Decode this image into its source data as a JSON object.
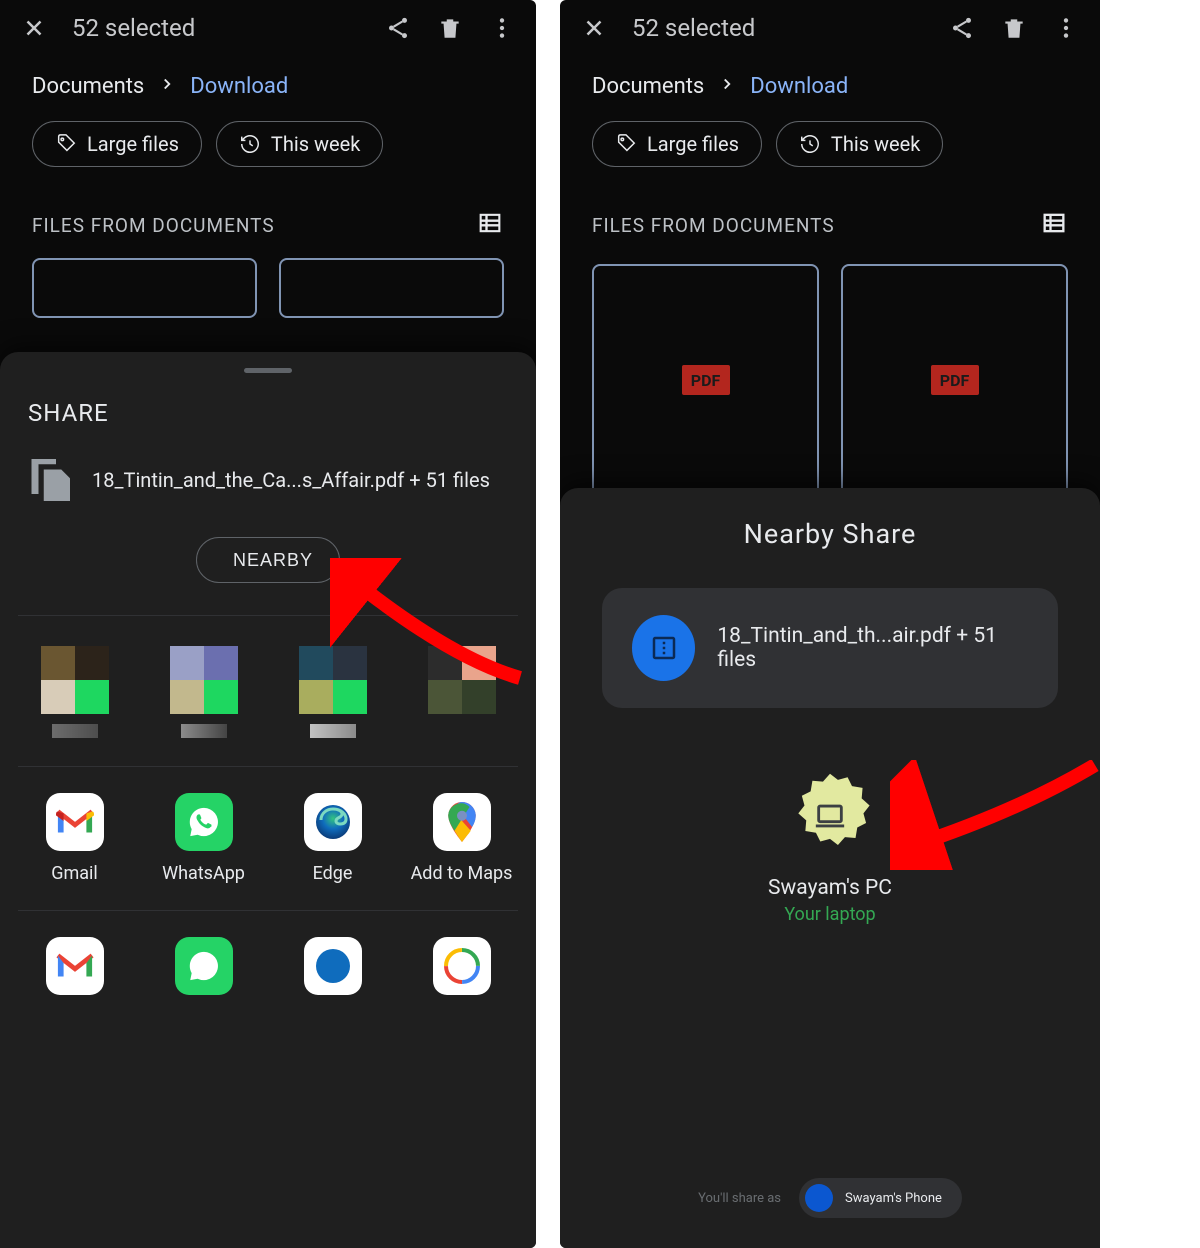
{
  "selection_count": "52 selected",
  "breadcrumb_root": "Documents",
  "breadcrumb_current": "Download",
  "chip_large_files": "Large files",
  "chip_this_week": "This week",
  "section_title": "FILES FROM DOCUMENTS",
  "pdf_badge": "PDF",
  "share_sheet": {
    "title": "SHARE",
    "file_summary": "18_Tintin_and_the_Ca...s_Affair.pdf + 51 files",
    "nearby_button": "NEARBY",
    "apps": [
      {
        "label": "Gmail"
      },
      {
        "label": "WhatsApp"
      },
      {
        "label": "Edge"
      },
      {
        "label": "Add to Maps"
      }
    ]
  },
  "nearby_sheet": {
    "title": "Nearby Share",
    "file_summary": "18_Tintin_and_th...air.pdf + 51 files",
    "device_name": "Swayam's PC",
    "device_subtitle": "Your laptop",
    "share_as_label": "You'll share as",
    "share_as_name": "Swayam's Phone"
  }
}
